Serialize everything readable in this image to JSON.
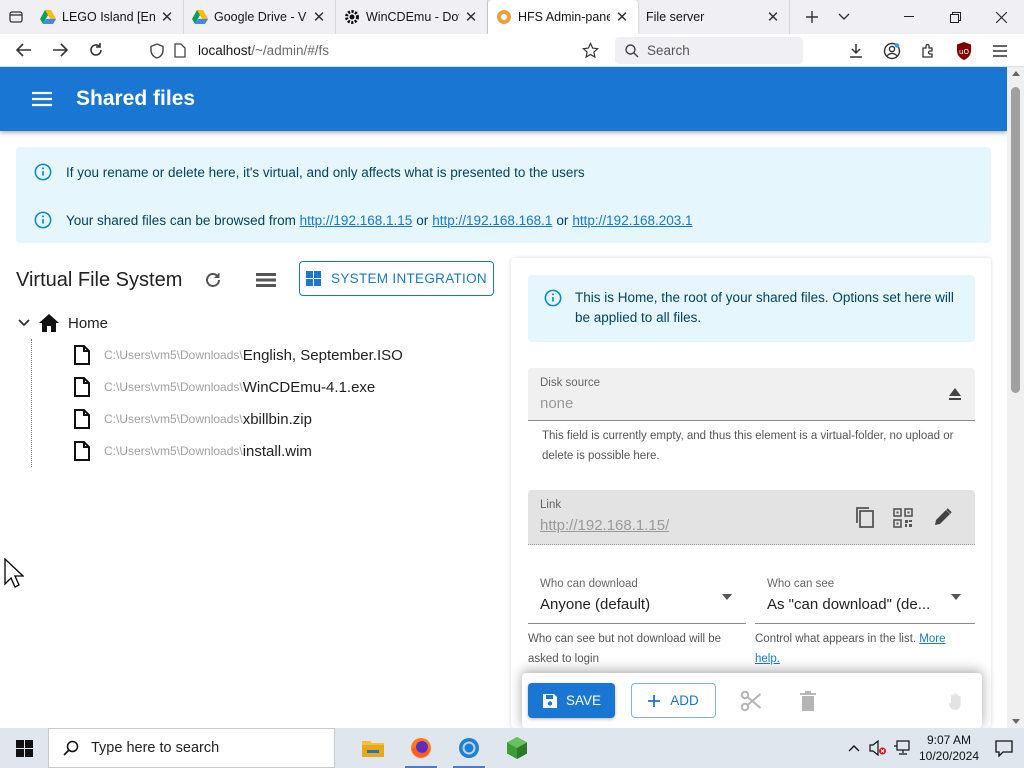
{
  "browser": {
    "tabs": [
      {
        "label": "LEGO Island [Engli",
        "favicon": "google-drive-icon",
        "active": false
      },
      {
        "label": "Google Drive - Vir",
        "favicon": "google-drive-icon",
        "active": false
      },
      {
        "label": "WinCDEmu - Dow",
        "favicon": "gear-icon",
        "active": false
      },
      {
        "label": "HFS Admin-panel",
        "favicon": "hfs-icon",
        "active": true
      },
      {
        "label": "File server",
        "favicon": "",
        "active": false
      }
    ],
    "url_host": "localhost",
    "url_path": "/~/admin/#/fs",
    "search_placeholder": "Search"
  },
  "app": {
    "title": "Shared files",
    "alerts": {
      "rename_notice": "If you rename or delete here, it's virtual, and only affects what is presented to the users",
      "browse_prefix": "Your shared files can be browsed from",
      "links": [
        "http://192.168.1.15",
        "http://192.168.168.1",
        "http://192.168.203.1"
      ],
      "or_word": "or"
    },
    "vfs": {
      "title": "Virtual File System",
      "system_integration_label": "SYSTEM INTEGRATION",
      "root_label": "Home",
      "files": [
        {
          "path": "C:\\Users\\vm5\\Downloads\\",
          "name": "English, September.ISO"
        },
        {
          "path": "C:\\Users\\vm5\\Downloads\\",
          "name": "WinCDEmu-4.1.exe"
        },
        {
          "path": "C:\\Users\\vm5\\Downloads\\",
          "name": "xbillbin.zip"
        },
        {
          "path": "C:\\Users\\vm5\\Downloads\\",
          "name": "install.wim"
        }
      ]
    },
    "panel": {
      "info": "This is Home, the root of your shared files. Options set here will be applied to all files.",
      "disk_source_label": "Disk source",
      "disk_source_value": "none",
      "disk_source_help": "This field is currently empty, and thus this element is a virtual-folder, no upload or delete is possible here.",
      "link_label": "Link",
      "link_value": "http://192.168.1.15/",
      "who_download_label": "Who can download",
      "who_download_value": "Anyone (default)",
      "who_download_help": "Who can see but not download will be asked to login",
      "who_see_label": "Who can see",
      "who_see_value": "As \"can download\" (de...",
      "who_see_help": "Control what appears in the list.",
      "more_help_label": "More help."
    },
    "actions": {
      "save_label": "SAVE",
      "add_label": "ADD"
    }
  },
  "taskbar": {
    "search_placeholder": "Type here to search",
    "time": "9:07 AM",
    "date": "10/20/2024"
  },
  "colors": {
    "primary": "#1976d2",
    "info_bg": "#e5f6fd",
    "info_text": "#014361"
  }
}
